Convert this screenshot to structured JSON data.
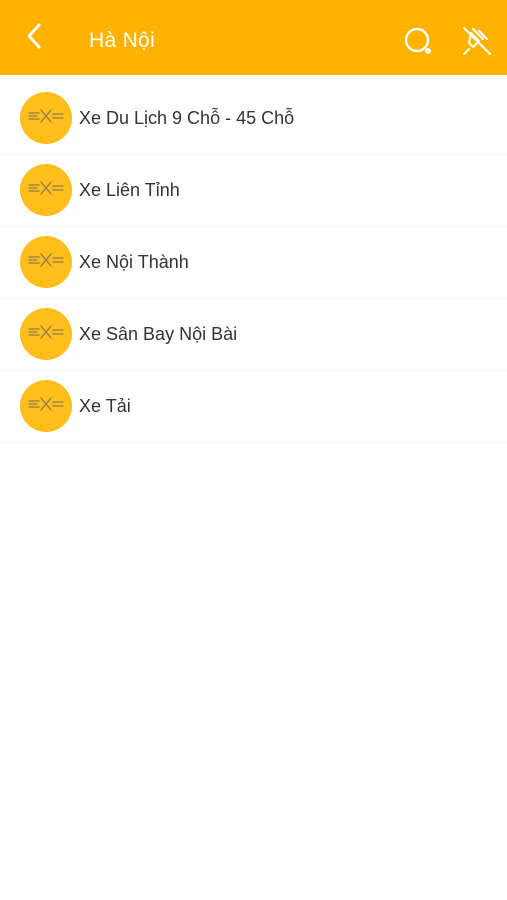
{
  "header": {
    "title": "Hà Nội",
    "background_color": "#FFB300",
    "back_icon": "chevron-left-icon",
    "search_icon": "search-icon",
    "unpin_icon": "unpin-icon"
  },
  "list": {
    "items": [
      {
        "label": "Xe Du Lịch 9 Chỗ - 45 Chỗ",
        "icon": "logo-icon"
      },
      {
        "label": "Xe Liên Tỉnh",
        "icon": "logo-icon"
      },
      {
        "label": "Xe Nội Thành",
        "icon": "logo-icon"
      },
      {
        "label": "Xe Sân Bay Nội Bài",
        "icon": "logo-icon"
      },
      {
        "label": "Xe Tải",
        "icon": "logo-icon"
      }
    ],
    "avatar_color": "#FFBE1A"
  }
}
